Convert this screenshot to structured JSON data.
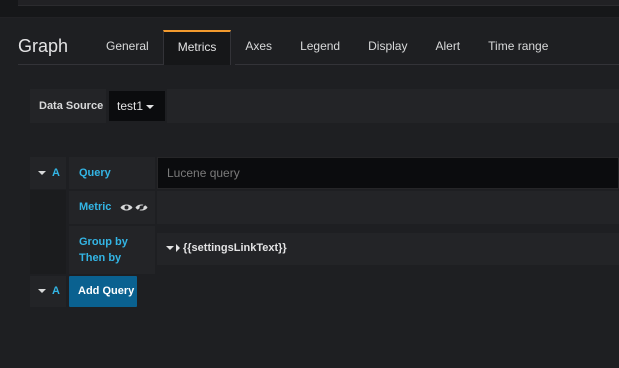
{
  "panel": {
    "title": "Graph"
  },
  "tabs": [
    {
      "label": "General"
    },
    {
      "label": "Metrics"
    },
    {
      "label": "Axes"
    },
    {
      "label": "Legend"
    },
    {
      "label": "Display"
    },
    {
      "label": "Alert"
    },
    {
      "label": "Time range"
    }
  ],
  "active_tab": "Metrics",
  "datasource": {
    "label": "Data Source",
    "value": "test1"
  },
  "query": {
    "ref_id": "A",
    "query_label": "Query",
    "query_placeholder": "Lucene query",
    "metric_label": "Metric",
    "group_by_label": "Group by",
    "then_by_label": "Then by",
    "settings_link_text": "{{settingsLinkText}}"
  },
  "add_query": {
    "ref_id": "A",
    "label": "Add Query"
  },
  "colors": {
    "accent_tab": "#f29a2e",
    "label_blue": "#33b5e5",
    "button_blue": "#0a6190"
  },
  "icons": [
    "caret-down-icon",
    "eye-icon",
    "eye-slash-icon",
    "caret-right-icon"
  ]
}
